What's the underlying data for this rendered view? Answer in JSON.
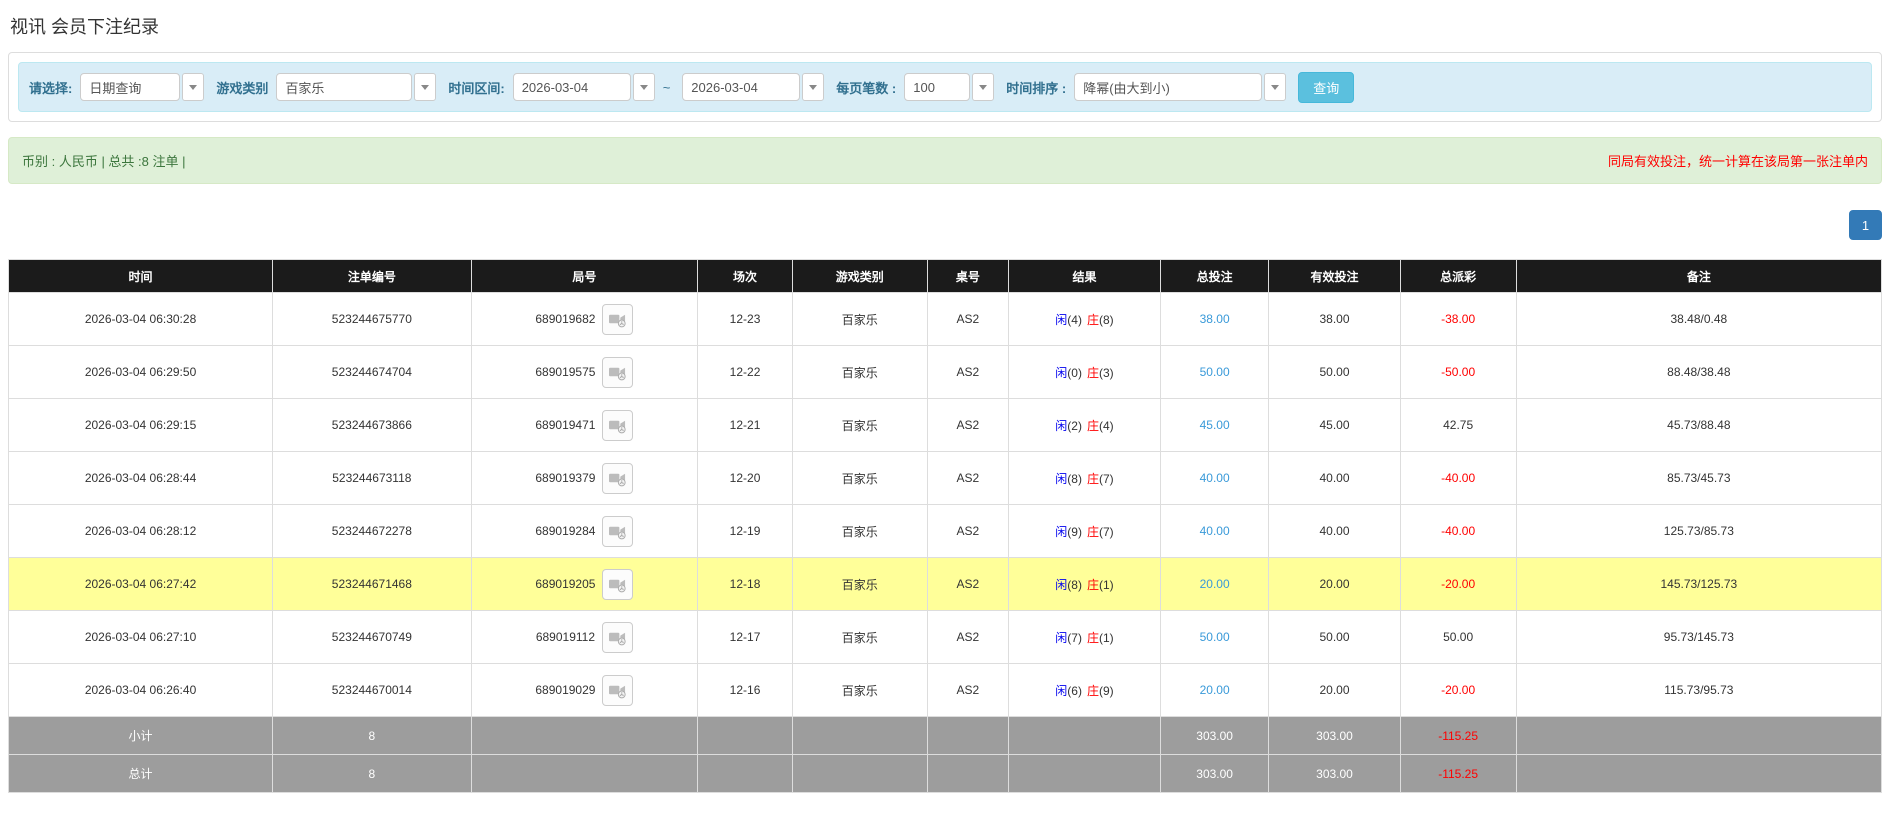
{
  "page_title": "视讯 会员下注纪录",
  "filters": {
    "select_label": "请选择:",
    "select_value": "日期查询",
    "game_type_label": "游戏类别",
    "game_type_value": "百家乐",
    "time_range_label": "时间区间:",
    "date_from": "2026-03-04",
    "tilde": "~",
    "date_to": "2026-03-04",
    "page_size_label": "每页笔数 :",
    "page_size_value": "100",
    "sort_label": "时间排序 :",
    "sort_value": "降幂(由大到小)",
    "search_button": "查询"
  },
  "summary_bar": {
    "left_text": "币别 : 人民币 | 总共 :8 注单 |",
    "right_notice": "同局有效投注，统一计算在该局第一张注单内"
  },
  "pagination": {
    "current_page": "1"
  },
  "colors": {
    "accent_blue": "#5bc0de",
    "link_blue": "#3a9ad9",
    "player_blue": "#0000ee",
    "banker_red": "#ff0000",
    "negative_red": "#ff0000",
    "highlight_yellow": "#ffff99",
    "header_black": "#1b1b1b",
    "summary_grey": "#9d9d9d",
    "alert_green_bg": "#dff0d8"
  },
  "table": {
    "headers": [
      "时间",
      "注单编号",
      "局号",
      "场次",
      "游戏类别",
      "桌号",
      "结果",
      "总投注",
      "有效投注",
      "总派彩",
      "备注"
    ],
    "rows": [
      {
        "time": "2026-03-04 06:30:28",
        "bet_id": "523244675770",
        "round_id": "689019682",
        "session": "12-23",
        "game": "百家乐",
        "table_no": "AS2",
        "player": "闲",
        "player_n": "(4)",
        "banker": "庄",
        "banker_n": "(8)",
        "total_bet": "38.00",
        "valid_bet": "38.00",
        "payout": "-38.00",
        "remark": "38.48/0.48"
      },
      {
        "time": "2026-03-04 06:29:50",
        "bet_id": "523244674704",
        "round_id": "689019575",
        "session": "12-22",
        "game": "百家乐",
        "table_no": "AS2",
        "player": "闲",
        "player_n": "(0)",
        "banker": "庄",
        "banker_n": "(3)",
        "total_bet": "50.00",
        "valid_bet": "50.00",
        "payout": "-50.00",
        "remark": "88.48/38.48"
      },
      {
        "time": "2026-03-04 06:29:15",
        "bet_id": "523244673866",
        "round_id": "689019471",
        "session": "12-21",
        "game": "百家乐",
        "table_no": "AS2",
        "player": "闲",
        "player_n": "(2)",
        "banker": "庄",
        "banker_n": "(4)",
        "total_bet": "45.00",
        "valid_bet": "45.00",
        "payout": "42.75",
        "remark": "45.73/88.48"
      },
      {
        "time": "2026-03-04 06:28:44",
        "bet_id": "523244673118",
        "round_id": "689019379",
        "session": "12-20",
        "game": "百家乐",
        "table_no": "AS2",
        "player": "闲",
        "player_n": "(8)",
        "banker": "庄",
        "banker_n": "(7)",
        "total_bet": "40.00",
        "valid_bet": "40.00",
        "payout": "-40.00",
        "remark": "85.73/45.73"
      },
      {
        "time": "2026-03-04 06:28:12",
        "bet_id": "523244672278",
        "round_id": "689019284",
        "session": "12-19",
        "game": "百家乐",
        "table_no": "AS2",
        "player": "闲",
        "player_n": "(9)",
        "banker": "庄",
        "banker_n": "(7)",
        "total_bet": "40.00",
        "valid_bet": "40.00",
        "payout": "-40.00",
        "remark": "125.73/85.73"
      },
      {
        "time": "2026-03-04 06:27:42",
        "bet_id": "523244671468",
        "round_id": "689019205",
        "session": "12-18",
        "game": "百家乐",
        "table_no": "AS2",
        "player": "闲",
        "player_n": "(8)",
        "banker": "庄",
        "banker_n": "(1)",
        "total_bet": "20.00",
        "valid_bet": "20.00",
        "payout": "-20.00",
        "remark": "145.73/125.73",
        "highlight": true
      },
      {
        "time": "2026-03-04 06:27:10",
        "bet_id": "523244670749",
        "round_id": "689019112",
        "session": "12-17",
        "game": "百家乐",
        "table_no": "AS2",
        "player": "闲",
        "player_n": "(7)",
        "banker": "庄",
        "banker_n": "(1)",
        "total_bet": "50.00",
        "valid_bet": "50.00",
        "payout": "50.00",
        "remark": "95.73/145.73"
      },
      {
        "time": "2026-03-04 06:26:40",
        "bet_id": "523244670014",
        "round_id": "689019029",
        "session": "12-16",
        "game": "百家乐",
        "table_no": "AS2",
        "player": "闲",
        "player_n": "(6)",
        "banker": "庄",
        "banker_n": "(9)",
        "total_bet": "20.00",
        "valid_bet": "20.00",
        "payout": "-20.00",
        "remark": "115.73/95.73"
      }
    ],
    "subtotal": {
      "label": "小计",
      "count": "8",
      "total_bet": "303.00",
      "valid_bet": "303.00",
      "payout": "-115.25"
    },
    "total": {
      "label": "总计",
      "count": "8",
      "total_bet": "303.00",
      "valid_bet": "303.00",
      "payout": "-115.25"
    }
  }
}
